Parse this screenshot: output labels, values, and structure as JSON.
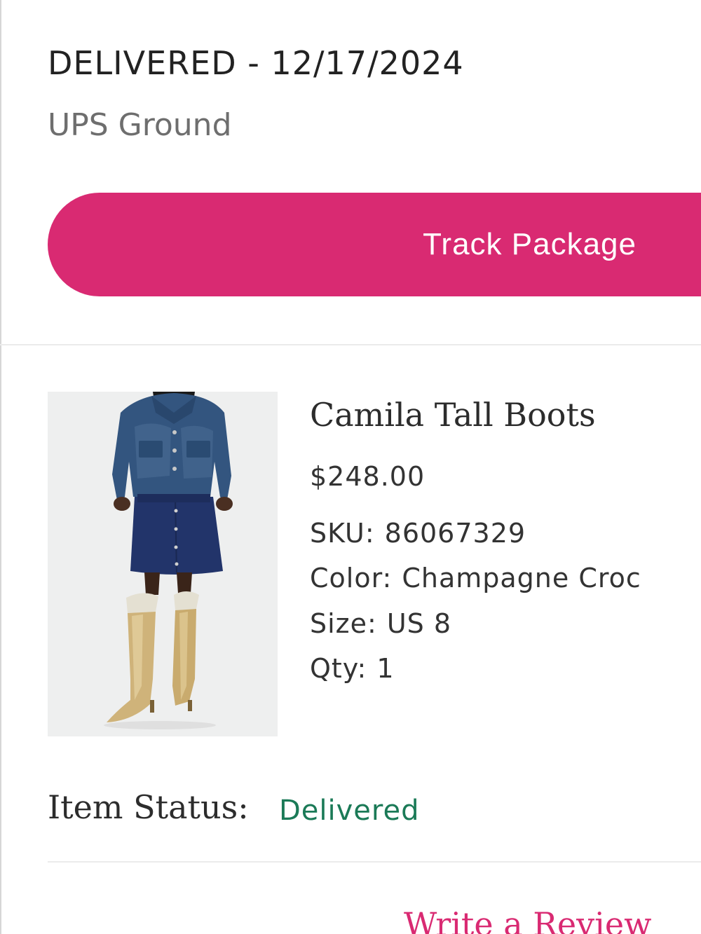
{
  "shipment": {
    "status_line": "DELIVERED - 12/17/2024",
    "carrier": "UPS Ground"
  },
  "actions": {
    "track_package_label": "Track Package",
    "write_review_label": "Write a Review"
  },
  "product": {
    "name": "Camila Tall Boots",
    "price": "$248.00",
    "sku_label": "SKU:",
    "sku_value": "86067329",
    "color_label": "Color:",
    "color_value": "Champagne Croc",
    "size_label": "Size:",
    "size_value": "US 8",
    "qty_label": "Qty:",
    "qty_value": "1"
  },
  "item_status": {
    "label": "Item Status:",
    "value": "Delivered"
  },
  "colors": {
    "accent": "#d92a72",
    "status_delivered": "#1b7a57",
    "text_primary": "#222222",
    "text_secondary": "#6e6e6e"
  }
}
